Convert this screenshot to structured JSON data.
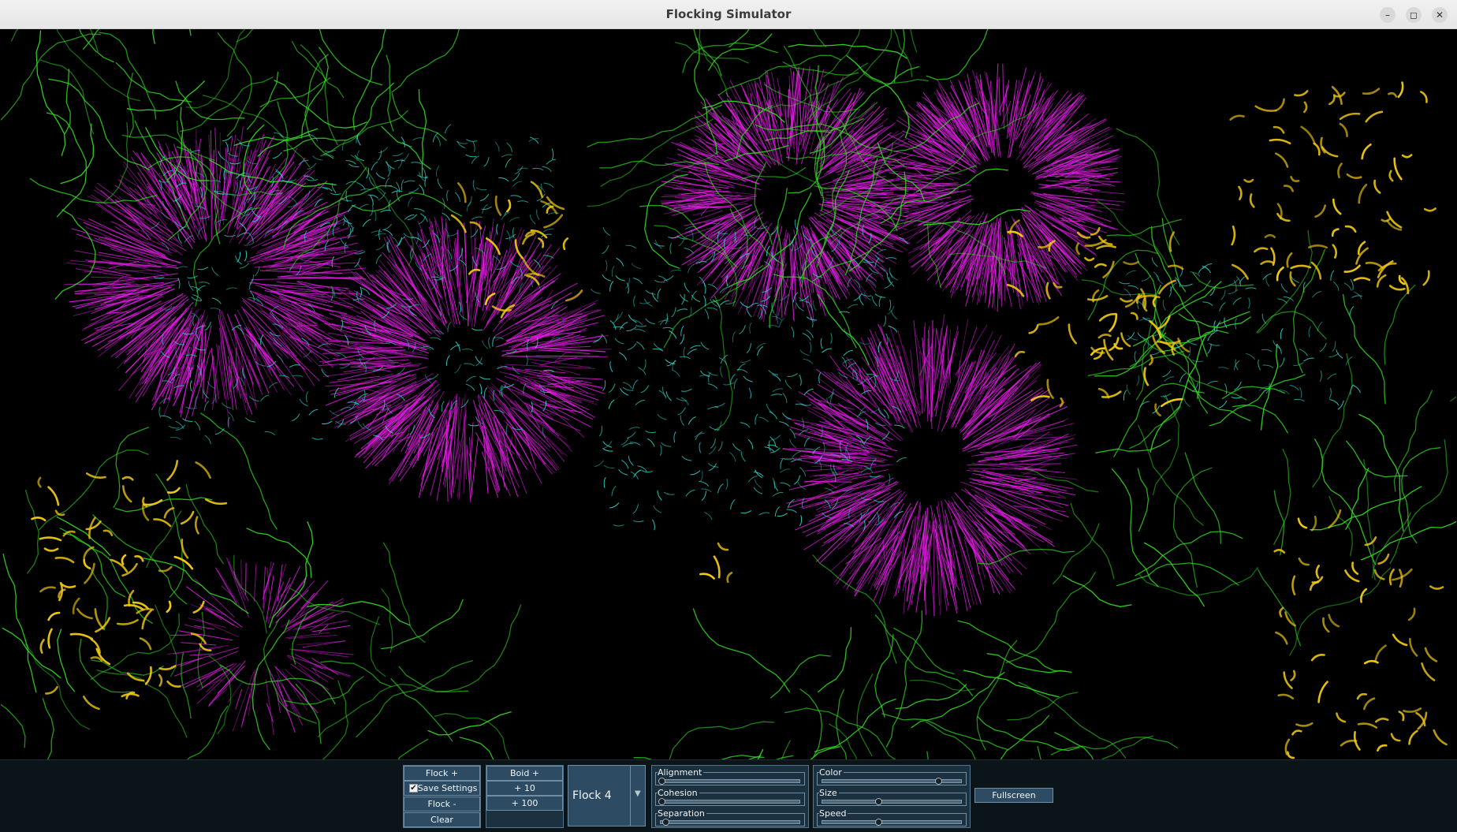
{
  "window": {
    "title": "Flocking Simulator",
    "controls": {
      "minimize": "–",
      "maximize": "◻",
      "close": "✕"
    }
  },
  "colors": {
    "background": "#000000",
    "flock_magenta": "#e51ee6",
    "flock_green": "#33dd22",
    "flock_cyan": "#2fd3c4",
    "flock_yellow": "#f2cb10",
    "panel": "#1c3140",
    "button": "#2d4c63"
  },
  "flock_buttons": {
    "add": "Flock +",
    "save_settings": "Save Settings",
    "save_checked": true,
    "remove": "Flock -",
    "clear": "Clear"
  },
  "boid_buttons": {
    "add": "Boid +",
    "add10": "+ 10",
    "add100": "+ 100"
  },
  "flock_select": {
    "selected": "Flock 4"
  },
  "behavior_sliders": [
    {
      "label": "Alignment",
      "value": 0.01
    },
    {
      "label": "Cohesion",
      "value": 0.01
    },
    {
      "label": "Separation",
      "value": 0.04
    }
  ],
  "appearance_sliders": [
    {
      "label": "Color",
      "value": 0.82
    },
    {
      "label": "Size",
      "value": 0.4
    },
    {
      "label": "Speed",
      "value": 0.4
    }
  ],
  "fullscreen_label": "Fullscreen"
}
